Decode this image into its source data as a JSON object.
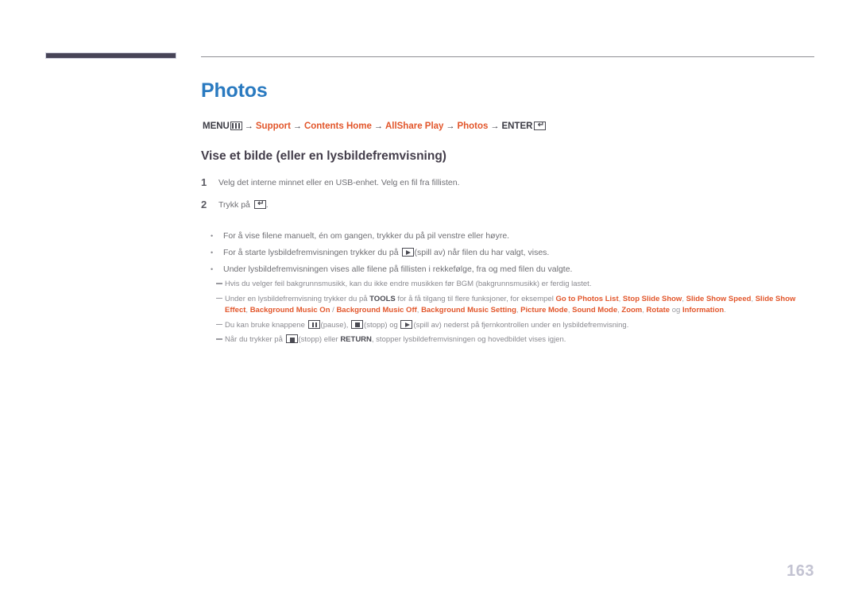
{
  "page": {
    "title": "Photos",
    "page_number": "163",
    "title_color": "#2a7ac0",
    "link_color": "#e2562b",
    "heading_color": "#433d4a",
    "rule_color": "#8e8e93",
    "bar_color": "#474457"
  },
  "breadcrumb": {
    "menu_label": "MENU",
    "menu_icon": "menu-bars-icon",
    "items": [
      {
        "label": "Support",
        "type": "link"
      },
      {
        "label": "Contents Home",
        "type": "link"
      },
      {
        "label": "AllShare Play",
        "type": "link"
      },
      {
        "label": "Photos",
        "type": "link"
      }
    ],
    "enter_label": "ENTER",
    "enter_icon": "enter-return-icon",
    "arrow": "→"
  },
  "section": {
    "heading": "Vise et bilde (eller en lysbildefremvisning)"
  },
  "steps": [
    {
      "number": "1",
      "text": "Velg det interne minnet eller en USB-enhet. Velg en fil fra fillisten."
    },
    {
      "number": "2",
      "text_before": "Trykk på ",
      "icon": "enter-return-icon",
      "text_after": "."
    }
  ],
  "bullets": [
    {
      "marker": "•",
      "text": "For å vise filene manuelt, én om gangen, trykker du på pil venstre eller høyre."
    },
    {
      "marker": "•",
      "text_before": "For å starte lysbildefremvisningen trykker du på ",
      "icon": "play-icon",
      "text_after": "(spill av) når filen du har valgt, vises."
    },
    {
      "marker": "•",
      "text": "Under lysbildefremvisningen vises alle filene på fillisten i rekkefølge, fra og med filen du valgte."
    }
  ],
  "notes": [
    {
      "id": "note-bgm",
      "text": "Hvis du velger feil bakgrunnsmusikk, kan du ikke endre musikken før BGM (bakgrunnsmusikk) er ferdig lastet."
    },
    {
      "id": "note-tools",
      "text_1": "Under en lysbildefremvisning trykker du på ",
      "bold_1": "TOOLS",
      "text_2": " for å få tilgang til flere funksjoner, for eksempel ",
      "options": [
        "Go to Photos List",
        "Stop Slide Show",
        "Slide Show Speed",
        "Slide Show Effect",
        "Background Music On",
        "Background Music Off",
        "Background Music Setting",
        "Picture Mode",
        "Sound Mode",
        "Zoom",
        "Rotate",
        "Information"
      ],
      "separator_slash": " / ",
      "separator_comma": ", ",
      "conjunction": " og ",
      "terminator": "."
    },
    {
      "id": "note-buttons",
      "text_1": "Du kan bruke knappene ",
      "icon_1": "pause-icon",
      "text_2": "(pause), ",
      "icon_2": "stop-icon",
      "text_3": "(stopp) og ",
      "icon_3": "play-icon",
      "text_4": "(spill av) nederst på fjernkontrollen under en lysbildefremvisning."
    },
    {
      "id": "note-return",
      "text_1": "Når du trykker på ",
      "icon_1": "stop-icon",
      "text_2": "(stopp) eller ",
      "bold_1": "RETURN",
      "text_3": ", stopper lysbildefremvisningen og hovedbildet vises igjen."
    }
  ]
}
